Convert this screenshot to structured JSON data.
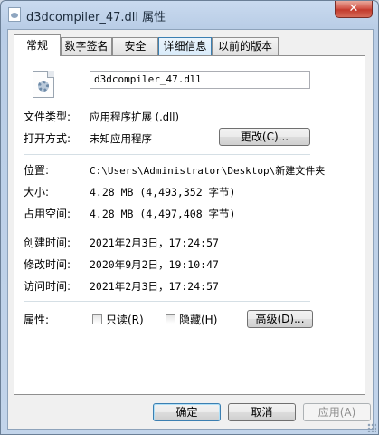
{
  "window": {
    "title": "d3dcompiler_47.dll 属性",
    "close_glyph": "✕"
  },
  "tabs": [
    {
      "label": "常规",
      "active": true
    },
    {
      "label": "数字签名"
    },
    {
      "label": "安全"
    },
    {
      "label": "详细信息"
    },
    {
      "label": "以前的版本"
    }
  ],
  "general": {
    "file_name": "d3dcompiler_47.dll",
    "rows": [
      {
        "label": "文件类型:",
        "value": "应用程序扩展 (.dll)"
      },
      {
        "label": "打开方式:",
        "value": "未知应用程序"
      },
      {
        "label": "位置:",
        "value": "C:\\Users\\Administrator\\Desktop\\新建文件夹"
      },
      {
        "label": "大小:",
        "value": "4.28 MB (4,493,352 字节)"
      },
      {
        "label": "占用空间:",
        "value": "4.28 MB (4,497,408 字节)"
      },
      {
        "label": "创建时间:",
        "value": "2021年2月3日，17:24:57"
      },
      {
        "label": "修改时间:",
        "value": "2020年9月2日，19:10:47"
      },
      {
        "label": "访问时间:",
        "value": "2021年2月3日，17:24:57"
      }
    ],
    "change_button": "更改(C)...",
    "attributes_label": "属性:",
    "readonly_label": "只读(R)",
    "hidden_label": "隐藏(H)",
    "advanced_button": "高级(D)..."
  },
  "footer": {
    "ok": "确定",
    "cancel": "取消",
    "apply": "应用(A)"
  },
  "icons": {
    "title": "dll-file-icon",
    "file": "dll-file-gear-icon"
  }
}
